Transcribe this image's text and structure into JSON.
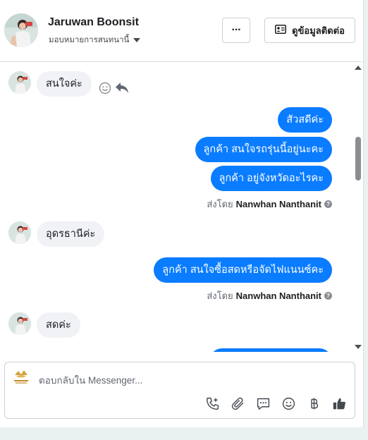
{
  "header": {
    "contact_name": "Jaruwan Boonsit",
    "assign_label": "มอบหมายการสนทนานี้",
    "more_label": "···",
    "contact_info_label": "ดูข้อมูลติดต่อ"
  },
  "messages": {
    "m1": "สนใจค่ะ",
    "m2": "สัวสดีค่ะ",
    "m3": "ลูกค้า  สนใจรถรุ่นนี้อยู่นะคะ",
    "m4": "ลูกค้า อยู่จังหวัดอะไรคะ",
    "sent1_prefix": "ส่งโดย",
    "sent1_name": "Nanwhan Nanthanit",
    "m5": "อุดรธานีค่ะ",
    "m6": "ลูกค้า สนใจซื้อสดหรือจัดไฟแนนซ์คะ",
    "sent2_prefix": "ส่งโดย",
    "sent2_name": "Nanwhan Nanthanit",
    "m7": "สดค่ะ"
  },
  "reply": {
    "placeholder": "ตอบกลับใน Messenger..."
  },
  "toolbar": {
    "icons": [
      "phone-add-icon",
      "attach-icon",
      "saved-reply-icon",
      "emoji-icon",
      "baht-icon",
      "like-icon"
    ]
  },
  "colors": {
    "outgoing_bubble": "#0a7cff",
    "incoming_bubble": "#f0f2f5"
  }
}
